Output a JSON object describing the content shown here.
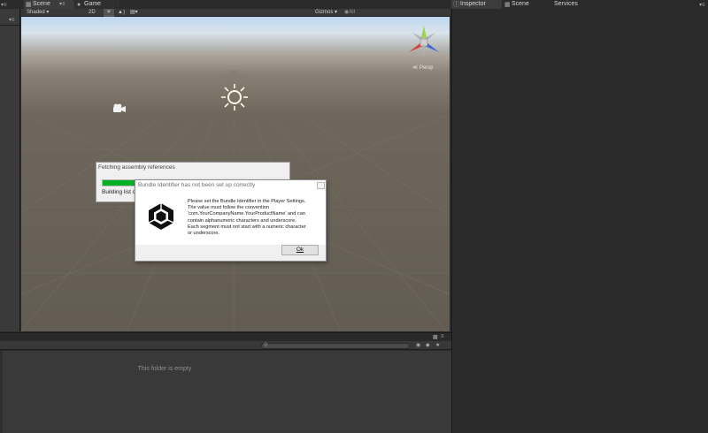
{
  "scene_panel": {
    "tabs": [
      {
        "label": "Scene",
        "icon": "scene-icon"
      },
      {
        "label": "Game",
        "icon": "game-icon"
      }
    ],
    "toolbar": {
      "shading_mode": "Shaded",
      "mode_2d": "2D",
      "gizmos_label": "Gizmos",
      "search_placeholder": "◉All"
    },
    "view_label": "Persp"
  },
  "inspector_panel": {
    "tabs": [
      {
        "label": "Inspector",
        "icon": "info-icon"
      },
      {
        "label": "Scene",
        "icon": "scene-icon"
      },
      {
        "label": "Services",
        "icon": ""
      }
    ]
  },
  "project_panel": {
    "empty_message": "This folder is empty"
  },
  "progress_dialog": {
    "title": "Fetching assembly references",
    "status": "Building list of",
    "progress": 0.18,
    "fill_color": "#06b025"
  },
  "alert_dialog": {
    "title": "Bundle Identifier has not been set up correctly",
    "message_lines": [
      "Please set the Bundle Identifier in the Player Settings.",
      "The value must follow the convention",
      "'com.YourCompanyName.YourProductName' and can",
      "contain alphanumeric characters and underscore.",
      "Each segment must not start with a numeric character",
      "or underscore."
    ],
    "ok_label": "Ok",
    "icon": "unity-logo-icon"
  },
  "colors": {
    "editor_dark": "#2b2b2b",
    "gizmo_x": "#d9403a",
    "gizmo_y": "#9bd54a",
    "gizmo_z": "#3a66d9"
  }
}
